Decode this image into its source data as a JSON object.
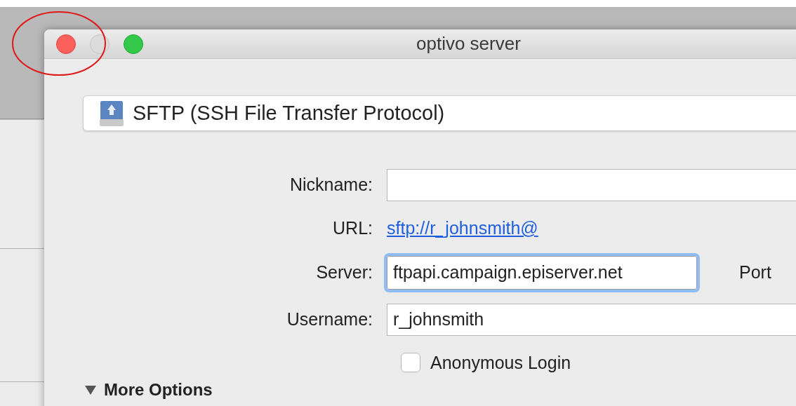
{
  "window": {
    "title": "optivo server"
  },
  "protocol": {
    "label": "SFTP (SSH File Transfer Protocol)"
  },
  "fields": [
    {
      "kind": "input",
      "label": "Nickname:",
      "focused": false
    },
    {
      "kind": "link",
      "label": "URL:",
      "value": "sftp://r_johnsmith@"
    },
    {
      "kind": "input",
      "label": "Server:",
      "value": "ftpapi.campaign.episerver.net",
      "focused": true,
      "side_label": "Port"
    },
    {
      "kind": "input",
      "label": "Username:",
      "value": "r_johnsmith",
      "focused": false
    }
  ],
  "anonymous_login": {
    "label": "Anonymous Login",
    "checked": false
  },
  "more_options": {
    "label": "More Options",
    "expanded": true
  }
}
